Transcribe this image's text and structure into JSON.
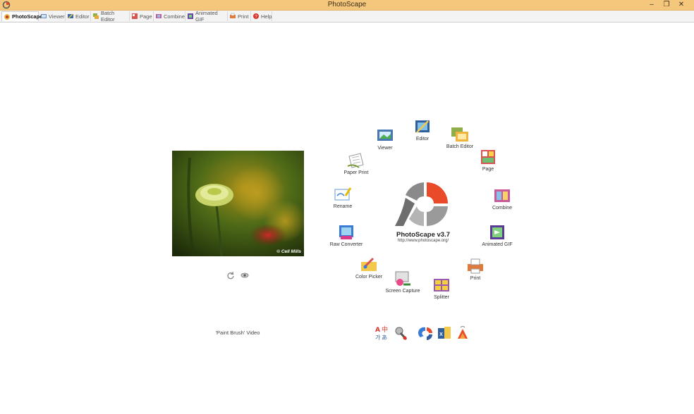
{
  "window": {
    "title": "PhotoScape",
    "controls": [
      "minimize-icon",
      "restore-icon",
      "close-icon"
    ]
  },
  "tabs": [
    {
      "label": "PhotoScape",
      "icon": "photoscape-icon",
      "active": true
    },
    {
      "label": "Viewer",
      "icon": "viewer-icon"
    },
    {
      "label": "Editor",
      "icon": "editor-icon"
    },
    {
      "label": "Batch Editor",
      "icon": "batch-editor-icon"
    },
    {
      "label": "Page",
      "icon": "page-icon"
    },
    {
      "label": "Combine",
      "icon": "combine-icon"
    },
    {
      "label": "Animated GIF",
      "icon": "animated-gif-icon"
    },
    {
      "label": "Print",
      "icon": "print-icon"
    },
    {
      "label": "Help",
      "icon": "help-icon"
    }
  ],
  "photo": {
    "credit": "© Cell Mills",
    "controls": [
      "refresh-icon",
      "eye-icon"
    ]
  },
  "video_link": "'Paint Brush' Video",
  "logo": {
    "title": "PhotoScape v3.7",
    "url": "http://www.photoscape.org/"
  },
  "hub": {
    "viewer": "Viewer",
    "editor": "Editor",
    "batch_editor": "Batch Editor",
    "page": "Page",
    "combine": "Combine",
    "animated_gif": "Animated GIF",
    "print": "Print",
    "splitter": "Splitter",
    "screen_capture": "Screen Capture",
    "color_picker": "Color Picker",
    "raw_converter": "Raw Converter",
    "rename": "Rename",
    "paper_print": "Paper Print"
  },
  "bottom_tools": [
    "language-icon",
    "tools-icon",
    "photoscape-app-icon",
    "photoscape-x-icon",
    "bell-icon"
  ],
  "colors": {
    "titlebar": "#f4c77c",
    "logo_accent": "#e84a2a",
    "logo_gray": "#8c8c8c"
  }
}
